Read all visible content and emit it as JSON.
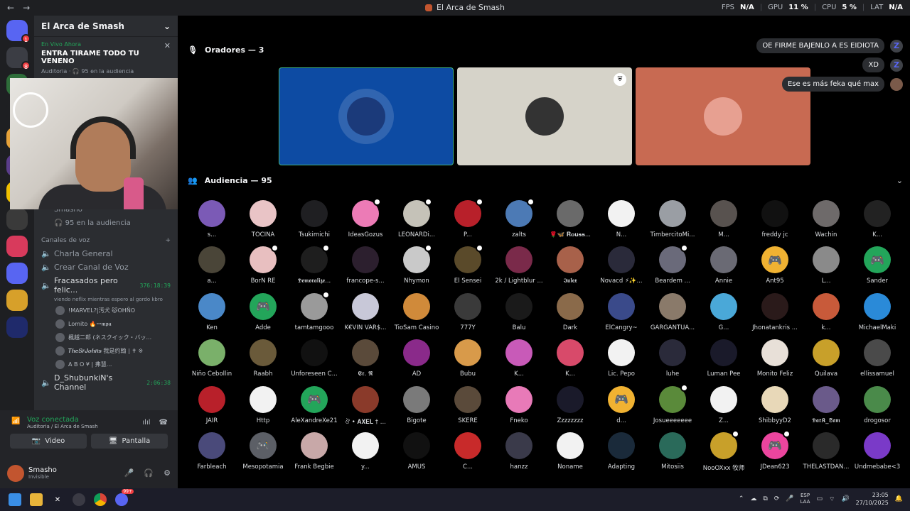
{
  "titlebar": {
    "back": "←",
    "forward": "→",
    "title": "El Arca de Smash",
    "fps_label": "FPS",
    "fps_value": "N/A",
    "gpu_label": "GPU",
    "gpu_value": "11 %",
    "cpu_label": "CPU",
    "cpu_value": "5 %",
    "lat_label": "LAT",
    "lat_value": "N/A"
  },
  "rail": [
    {
      "badge": "1",
      "color": "#5865f2"
    },
    {
      "badge": "8",
      "color": "#3b3d44"
    },
    {
      "badge": "",
      "color": "#2e6d3a"
    },
    {
      "badge": "",
      "color": "#1e1f22"
    },
    {
      "badge": "",
      "color": "#e6a23a"
    },
    {
      "badge": "2",
      "color": "#5a3d8a"
    },
    {
      "badge": "",
      "color": "#f0c000"
    },
    {
      "badge": "",
      "color": "#3a3a3a"
    },
    {
      "badge": "",
      "color": "#d83a5c"
    },
    {
      "badge": "",
      "color": "#5865f2"
    },
    {
      "badge": "",
      "color": "#d7a02a"
    },
    {
      "badge": "",
      "color": "#1f2a6b"
    }
  ],
  "sidebar": {
    "server_name": "El Arca de Smash",
    "live_tag": "En Vivo Ahora",
    "live_title": "ENTRA TIRAME TODO TU VENENO",
    "live_sub": "Auditoria · 🎧 95 en la audiencia",
    "stage_user": "Smasho",
    "stage_audience": "95 en la audiencia",
    "voice_header": "Canales de voz",
    "channels": {
      "general": "Charla General",
      "create": "Crear Canal de Voz",
      "fracasados": "Fracasados pero felic...",
      "fracasados_time": "376:18:39",
      "fracasados_sub": "viendo neflix mientras espero al gordo kbro",
      "shubunkin": "D_ShubunkiN's Channel",
      "shubunkin_time": "2:06:38",
      "live_badge": "EN VIVO"
    },
    "members": [
      "!MARVEL?|汚犬 🐱OHÑO",
      "Lomito 🔥ꟷ𝖒𝖕𝖆",
      "楓越二郎 (ネスクイック・バッ...",
      "𝑻𝒉𝒆𝑺𝒓𝑱𝒐𝒉𝒏𝒔 我是约翰 | ✝ ※",
      "A B O ¥ | 弗慧..."
    ]
  },
  "voice": {
    "status": "Voz conectada",
    "location": "Auditoria / El Arca de Smash",
    "video_label": "Video",
    "screen_label": "Pantalla"
  },
  "user": {
    "name": "Smasho",
    "status": "Invisible"
  },
  "stage": {
    "speakers_header": "Oradores — 3",
    "audience_header": "Audiencia — 95",
    "tiles": [
      {
        "bg": "#0d4ba3",
        "avatar": "#1b3a7a",
        "border": "#43b581",
        "mod": false
      },
      {
        "bg": "#d6d3c9",
        "avatar": "#333333",
        "border": "",
        "mod": true
      },
      {
        "bg": "#c86a52",
        "avatar": "#e7a091",
        "border": "",
        "mod": false
      }
    ],
    "chat": [
      {
        "text": "OE FIRME BAJENLO A ES EIDIOTA",
        "icon": "Z"
      },
      {
        "text": "XD",
        "icon": "Z"
      },
      {
        "text": "Ese es más feka qué max",
        "icon": ""
      }
    ]
  },
  "audience": [
    {
      "name": "s...",
      "color": "#7b5ab6",
      "mod": false,
      "discord": false
    },
    {
      "name": "TOCINA",
      "color": "#e9c4c6",
      "mod": false,
      "discord": false
    },
    {
      "name": "Tsukimichi",
      "color": "#1f1f22",
      "mod": false,
      "discord": false
    },
    {
      "name": "IdeasGozus",
      "color": "#ec7bb6",
      "mod": true,
      "discord": false
    },
    {
      "name": "LEONARDi...",
      "color": "#c5c2b8",
      "mod": true,
      "discord": false
    },
    {
      "name": "P...",
      "color": "#b8202a",
      "mod": true,
      "discord": false
    },
    {
      "name": "zalts",
      "color": "#4c7ab5",
      "mod": true,
      "discord": false
    },
    {
      "name": "🌹🦋 𝐑𝐨𝐮𝐬𝐬...",
      "color": "#6a6a6a",
      "mod": false,
      "discord": false
    },
    {
      "name": "N...",
      "color": "#f2f2f2",
      "mod": false,
      "discord": false
    },
    {
      "name": "TimbercitoMi...",
      "color": "#9a9ea4",
      "mod": false,
      "discord": false
    },
    {
      "name": "M...",
      "color": "#58524f",
      "mod": false,
      "discord": false
    },
    {
      "name": "freddy jc",
      "color": "#111111",
      "mod": false,
      "discord": false
    },
    {
      "name": "Wachin",
      "color": "#6e6a6a",
      "mod": false,
      "discord": false
    },
    {
      "name": "K...",
      "color": "#222222",
      "mod": false,
      "discord": false
    },
    {
      "name": "a...",
      "color": "#4a4538",
      "mod": false,
      "discord": false
    },
    {
      "name": "BorN RE",
      "color": "#e8bfc0",
      "mod": true,
      "discord": false
    },
    {
      "name": "𝕯𝖊𝖒𝖔𝖗𝖆𝖑𝖎𝖟𝖊...",
      "color": "#1e1e1e",
      "mod": true,
      "discord": false
    },
    {
      "name": "francope-s...",
      "color": "#2c1f2e",
      "mod": false,
      "discord": false
    },
    {
      "name": "Nhymon",
      "color": "#c9c9c9",
      "mod": true,
      "discord": false
    },
    {
      "name": "El Sensei",
      "color": "#5a4a2a",
      "mod": true,
      "discord": false
    },
    {
      "name": "2k / Lightblur ...",
      "color": "#7a2a4a",
      "mod": false,
      "discord": false
    },
    {
      "name": "𝕴𝖚𝖑𝖊𝖝",
      "color": "#a8614a",
      "mod": false,
      "discord": false
    },
    {
      "name": "Novacd ⚡✨...",
      "color": "#2a2a3a",
      "mod": false,
      "discord": false
    },
    {
      "name": "Beardem ...",
      "color": "#6a6a7a",
      "mod": true,
      "discord": false
    },
    {
      "name": "Annie",
      "color": "#6a6a74",
      "mod": false,
      "discord": false
    },
    {
      "name": "Ant95",
      "color": "#f0b232",
      "mod": false,
      "discord": true
    },
    {
      "name": "L...",
      "color": "#8a8a8a",
      "mod": false,
      "discord": false
    },
    {
      "name": "Sander",
      "color": "#23a55a",
      "mod": false,
      "discord": true
    },
    {
      "name": "Ken",
      "color": "#4a88c8",
      "mod": false,
      "discord": false
    },
    {
      "name": "Adde",
      "color": "#23a55a",
      "mod": false,
      "discord": true
    },
    {
      "name": "tamtamgooo",
      "color": "#9a9a9a",
      "mod": true,
      "discord": false
    },
    {
      "name": "K€VIN VAR$...",
      "color": "#c8c8d8",
      "mod": false,
      "discord": false
    },
    {
      "name": "TioSam Casino",
      "color": "#d08a3a",
      "mod": false,
      "discord": false
    },
    {
      "name": "777Y",
      "color": "#3a3a3a",
      "mod": false,
      "discord": false
    },
    {
      "name": "Balu",
      "color": "#1a1a1a",
      "mod": false,
      "discord": false
    },
    {
      "name": "Dark",
      "color": "#8a6a4a",
      "mod": false,
      "discord": false
    },
    {
      "name": "ElCangry~",
      "color": "#3a4a8a",
      "mod": false,
      "discord": false
    },
    {
      "name": "GARGANTUA...",
      "color": "#8a7a6a",
      "mod": false,
      "discord": false
    },
    {
      "name": "G...",
      "color": "#4aa8d8",
      "mod": false,
      "discord": false
    },
    {
      "name": "Jhonatankris ...",
      "color": "#2a1a1a",
      "mod": false,
      "discord": false
    },
    {
      "name": "k...",
      "color": "#c85a3a",
      "mod": false,
      "discord": false
    },
    {
      "name": "MichaelMaki",
      "color": "#2a8ad8",
      "mod": false,
      "discord": false
    },
    {
      "name": "Niño Cebollin",
      "color": "#7ab06a",
      "mod": false,
      "discord": false
    },
    {
      "name": "Raabh",
      "color": "#6a5a3a",
      "mod": false,
      "discord": false
    },
    {
      "name": "Unforeseen C...",
      "color": "#111111",
      "mod": false,
      "discord": false
    },
    {
      "name": "𝕰𝖗. 𝕽",
      "color": "#5a4a3a",
      "mod": false,
      "discord": false
    },
    {
      "name": "AD",
      "color": "#8a2a8a",
      "mod": false,
      "discord": false
    },
    {
      "name": "Bubu",
      "color": "#d89a4a",
      "mod": false,
      "discord": false
    },
    {
      "name": "K...",
      "color": "#c85ab8",
      "mod": false,
      "discord": false
    },
    {
      "name": "K...",
      "color": "#d84a6a",
      "mod": false,
      "discord": false
    },
    {
      "name": "Lic. Pepo",
      "color": "#f2f2f2",
      "mod": false,
      "discord": false
    },
    {
      "name": "luhe",
      "color": "#2a2a3a",
      "mod": false,
      "discord": false
    },
    {
      "name": "Luman Pee",
      "color": "#1a1a2a",
      "mod": false,
      "discord": false
    },
    {
      "name": "Monito Feliz",
      "color": "#e8e0d8",
      "mod": false,
      "discord": false
    },
    {
      "name": "Quilava",
      "color": "#c8a02a",
      "mod": false,
      "discord": false
    },
    {
      "name": "ellissamuel",
      "color": "#4a4a4a",
      "mod": false,
      "discord": false
    },
    {
      "name": "JAIR",
      "color": "#b8202a",
      "mod": false,
      "discord": false
    },
    {
      "name": "Http",
      "color": "#f2f2f2",
      "mod": false,
      "discord": false
    },
    {
      "name": "AleXandreXe21",
      "color": "#23a55a",
      "mod": false,
      "discord": true
    },
    {
      "name": "ঔ • 𝐀𝐗𝐄𝐋 † ...",
      "color": "#8a3a2a",
      "mod": false,
      "discord": false
    },
    {
      "name": "Bigote",
      "color": "#7a7a7a",
      "mod": false,
      "discord": false
    },
    {
      "name": "SKERE",
      "color": "#5a4a3a",
      "mod": false,
      "discord": false
    },
    {
      "name": "Fneko",
      "color": "#e87ab8",
      "mod": false,
      "discord": false
    },
    {
      "name": "Zzzzzzzz",
      "color": "#1a1a2a",
      "mod": false,
      "discord": false
    },
    {
      "name": "d...",
      "color": "#f0b232",
      "mod": false,
      "discord": true
    },
    {
      "name": "Josueeeeeee",
      "color": "#5a8a3a",
      "mod": true,
      "discord": false
    },
    {
      "name": "Z...",
      "color": "#f2f2f2",
      "mod": false,
      "discord": false
    },
    {
      "name": "ShibbyyD2",
      "color": "#e8d8b8",
      "mod": false,
      "discord": false
    },
    {
      "name": "𝕯𝖆𝖗𝕶_𝕾𝖆𝖒",
      "color": "#6a5a8a",
      "mod": false,
      "discord": false
    },
    {
      "name": "drogosor",
      "color": "#4a8a4a",
      "mod": false,
      "discord": false
    },
    {
      "name": "Farbleach",
      "color": "#4a4a7a",
      "mod": false,
      "discord": false
    },
    {
      "name": "Mesopotamia",
      "color": "#5c5f66",
      "mod": false,
      "discord": true
    },
    {
      "name": "Frank Begbie",
      "color": "#c8a8a8",
      "mod": false,
      "discord": false
    },
    {
      "name": "y...",
      "color": "#f2f2f2",
      "mod": false,
      "discord": false
    },
    {
      "name": "AMUS",
      "color": "#111111",
      "mod": false,
      "discord": false
    },
    {
      "name": "C...",
      "color": "#c82a2a",
      "mod": false,
      "discord": false
    },
    {
      "name": "hanzz",
      "color": "#3a3a4a",
      "mod": false,
      "discord": false
    },
    {
      "name": "Noname",
      "color": "#f2f2f2",
      "mod": false,
      "discord": false
    },
    {
      "name": "Adapting",
      "color": "#1a2a3a",
      "mod": false,
      "discord": false
    },
    {
      "name": "Mitosiis",
      "color": "#2a6a5a",
      "mod": false,
      "discord": false
    },
    {
      "name": "NooOXxx 牧师",
      "color": "#c8a02a",
      "mod": true,
      "discord": false
    },
    {
      "name": "JDean623",
      "color": "#eb459e",
      "mod": true,
      "discord": true
    },
    {
      "name": "THELASTDAN...",
      "color": "#2a2a2a",
      "mod": false,
      "discord": false
    },
    {
      "name": "Undmebabe<3",
      "color": "#7a3ac8",
      "mod": false,
      "discord": false
    }
  ],
  "taskbar": {
    "lang_top": "ESP",
    "lang_bottom": "LAA",
    "time": "23:05",
    "date": "27/10/2025",
    "discord_badge": "99+"
  }
}
